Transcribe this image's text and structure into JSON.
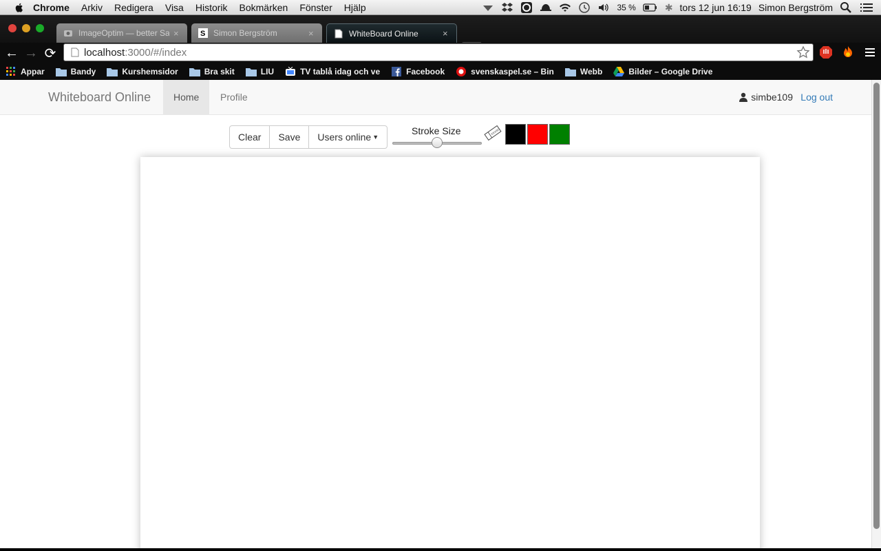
{
  "menubar": {
    "app": "Chrome",
    "items": [
      "Arkiv",
      "Redigera",
      "Visa",
      "Historik",
      "Bokmärken",
      "Fönster",
      "Hjälp"
    ],
    "battery": "35 %",
    "datetime": "tors 12 jun  16:19",
    "user": "Simon Bergström"
  },
  "tabs": [
    {
      "title": "ImageOptim — better Save",
      "active": false
    },
    {
      "title": "Simon Bergström",
      "active": false
    },
    {
      "title": "WhiteBoard Online",
      "active": true
    }
  ],
  "omnibox": {
    "host": "localhost",
    "path": ":3000/#/index"
  },
  "bookmarks": [
    {
      "label": "Appar",
      "icon": "apps-grid-icon"
    },
    {
      "label": "Bandy",
      "icon": "folder-icon"
    },
    {
      "label": "Kurshemsidor",
      "icon": "folder-icon"
    },
    {
      "label": "Bra skit",
      "icon": "folder-icon"
    },
    {
      "label": "LIU",
      "icon": "folder-icon"
    },
    {
      "label": "TV tablå idag och ve",
      "icon": "tv-icon"
    },
    {
      "label": "Facebook",
      "icon": "facebook-icon"
    },
    {
      "label": "svenskaspel.se – Bin",
      "icon": "svenskaspel-icon"
    },
    {
      "label": "Webb",
      "icon": "folder-icon"
    },
    {
      "label": "Bilder – Google Drive",
      "icon": "google-drive-icon"
    }
  ],
  "navbar": {
    "brand": "Whiteboard Online",
    "links": [
      "Home",
      "Profile"
    ],
    "active": "Home",
    "username": "simbe109",
    "logout": "Log out"
  },
  "tools": {
    "clear": "Clear",
    "save": "Save",
    "users_online": "Users online",
    "stroke_label": "Stroke Size",
    "stroke_value_fraction": 0.5,
    "colors": [
      "#000000",
      "#ff0000",
      "#008000"
    ]
  }
}
